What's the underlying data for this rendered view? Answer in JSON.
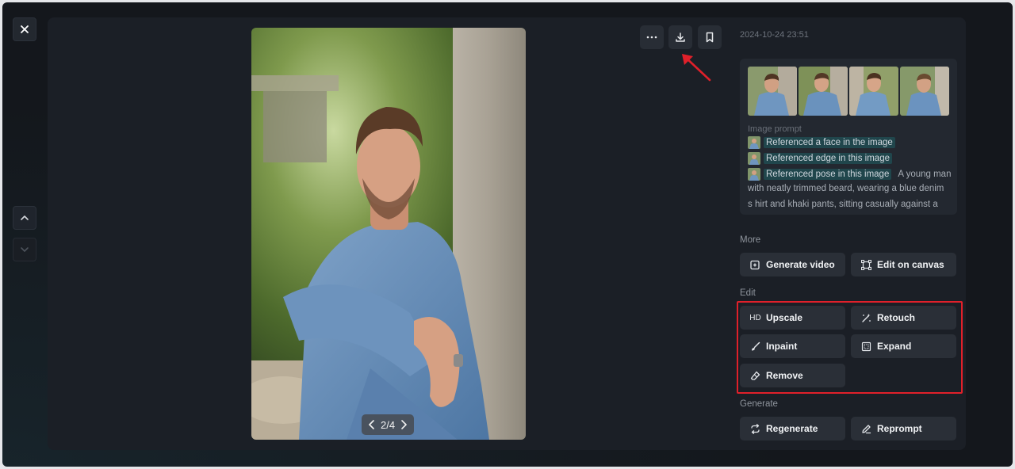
{
  "window": {
    "close_icon": "close-icon",
    "nav_up_icon": "chevron-up-icon",
    "nav_down_icon": "chevron-down-icon"
  },
  "image": {
    "pager_text": "2/4",
    "prev_icon": "chevron-left-icon",
    "next_icon": "chevron-right-icon"
  },
  "toolbar": {
    "more_icon": "more-icon",
    "download_icon": "download-icon",
    "bookmark_icon": "bookmark-icon"
  },
  "details": {
    "date": "2024-10-24 23:51",
    "prompt_label": "Image prompt",
    "references": [
      "Referenced a face in the image",
      "Referenced edge in this image",
      "Referenced pose in this image"
    ],
    "prompt_inline": "A young man",
    "prompt_rest": "with neatly trimmed beard, wearing a blue denim s hirt and khaki pants, sitting casually against a ston"
  },
  "sections": {
    "more": "More",
    "edit": "Edit",
    "generate": "Generate"
  },
  "actions": {
    "generate_video": "Generate video",
    "edit_on_canvas": "Edit on canvas",
    "upscale_badge": "HD",
    "upscale": "Upscale",
    "retouch": "Retouch",
    "inpaint": "Inpaint",
    "expand": "Expand",
    "remove": "Remove",
    "regenerate": "Regenerate",
    "reprompt": "Reprompt"
  },
  "colors": {
    "annotation_red": "#e0202a",
    "reference_tag_bg": "#20464c",
    "panel_bg": "#1b1f26"
  }
}
